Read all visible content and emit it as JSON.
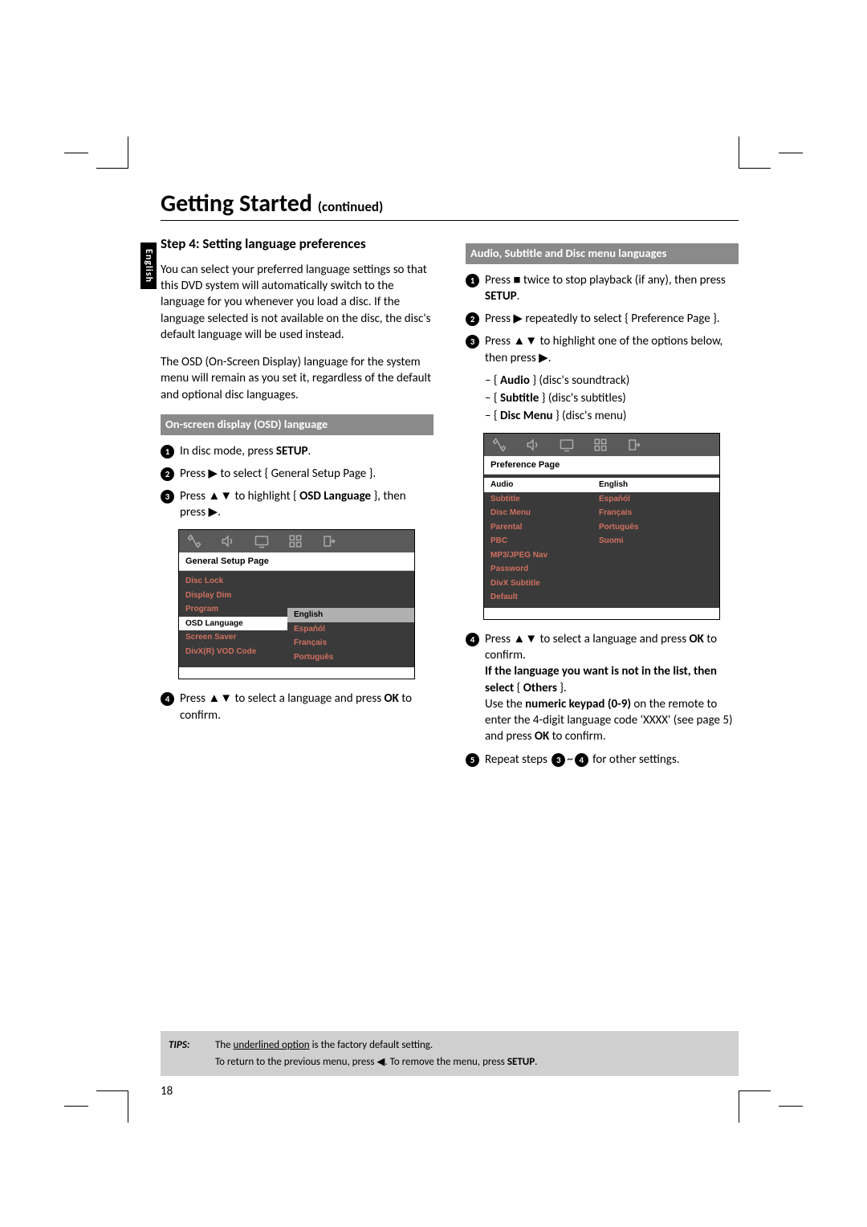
{
  "language_tab": "English",
  "title": "Getting Started",
  "title_cont": "(continued)",
  "step_head": "Step 4: Setting language preferences",
  "para1": "You can select your preferred language settings so that this DVD system will automatically switch to the language for you whenever you load a disc. If the language selected is not available on the disc, the disc's default language will be used instead.",
  "para2": "The OSD (On-Screen Display) language for the system menu will remain as you set it, regardless of the default and optional disc languages.",
  "section_osd": "On-screen display (OSD) language",
  "osd_steps": {
    "s1_a": "In disc mode, press ",
    "s1_b": "SETUP",
    "s1_c": ".",
    "s2_a": "Press ",
    "s2_b": " to select { General Setup Page }.",
    "s3_a": "Press ",
    "s3_b": " to highlight { ",
    "s3_c": "OSD Language",
    "s3_d": " }, then press ",
    "s4_a": "Press ",
    "s4_b": " to select a language and press ",
    "s4_c": "OK",
    "s4_d": " to confirm."
  },
  "section_audio": "Audio, Subtitle and Disc menu languages",
  "audio_steps": {
    "s1_a": "Press ",
    "s1_b": " twice to stop playback (if any), then press ",
    "s1_c": "SETUP",
    "s1_d": ".",
    "s2_a": "Press ",
    "s2_b": " repeatedly to select { Preference Page }.",
    "s3_a": "Press ",
    "s3_b": " to highlight one of the options below, then press ",
    "opt1_a": "– { ",
    "opt1_b": "Audio",
    "opt1_c": " } (disc's soundtrack)",
    "opt2_a": "– { ",
    "opt2_b": "Subtitle",
    "opt2_c": " } (disc's subtitles)",
    "opt3_a": "– { ",
    "opt3_b": "Disc Menu",
    "opt3_c": " } (disc's menu)",
    "s4_a": "Press ",
    "s4_b": " to select a language and press ",
    "s4_c": "OK",
    "s4_d": " to confirm.",
    "s4_e": "If the language you want is not in the list, then select",
    "s4_f": " { ",
    "s4_g": "Others",
    "s4_h": " }.",
    "s4_i": "Use the ",
    "s4_j": "numeric keypad (0-9)",
    "s4_k": " on the remote to enter the 4-digit language code 'XXXX' (see page 5) and press ",
    "s4_l": "OK",
    "s4_m": " to confirm.",
    "s5_a": "Repeat steps ",
    "s5_b": "~",
    "s5_c": " for other settings."
  },
  "osd_box1": {
    "title": "General Setup Page",
    "left": [
      "Disc Lock",
      "Display Dim",
      "Program",
      "OSD Language",
      "Screen Saver",
      "DivX(R) VOD Code"
    ],
    "right": [
      "English",
      "Espaňól",
      "Français",
      "Português"
    ]
  },
  "osd_box2": {
    "title": "Preference Page",
    "left": [
      "Audio",
      "Subtitle",
      "Disc Menu",
      "Parental",
      "PBC",
      "MP3/JPEG Nav",
      "Password",
      "DivX Subtitle",
      "Default"
    ],
    "right": [
      "English",
      "Espaňól",
      "Français",
      "Português",
      "Suomi"
    ]
  },
  "glyphs": {
    "right": "▶",
    "updown": "▲▼",
    "stop": "■",
    "left": "◀",
    "dot": "."
  },
  "tips": {
    "label": "TIPS:",
    "line1a": "The ",
    "line1b": "underlined option",
    "line1c": " is the factory default setting.",
    "line2a": "To return to the previous menu, press ",
    "line2b": ". To remove the menu, press ",
    "line2c": "SETUP",
    "line2d": "."
  },
  "page_number": "18"
}
